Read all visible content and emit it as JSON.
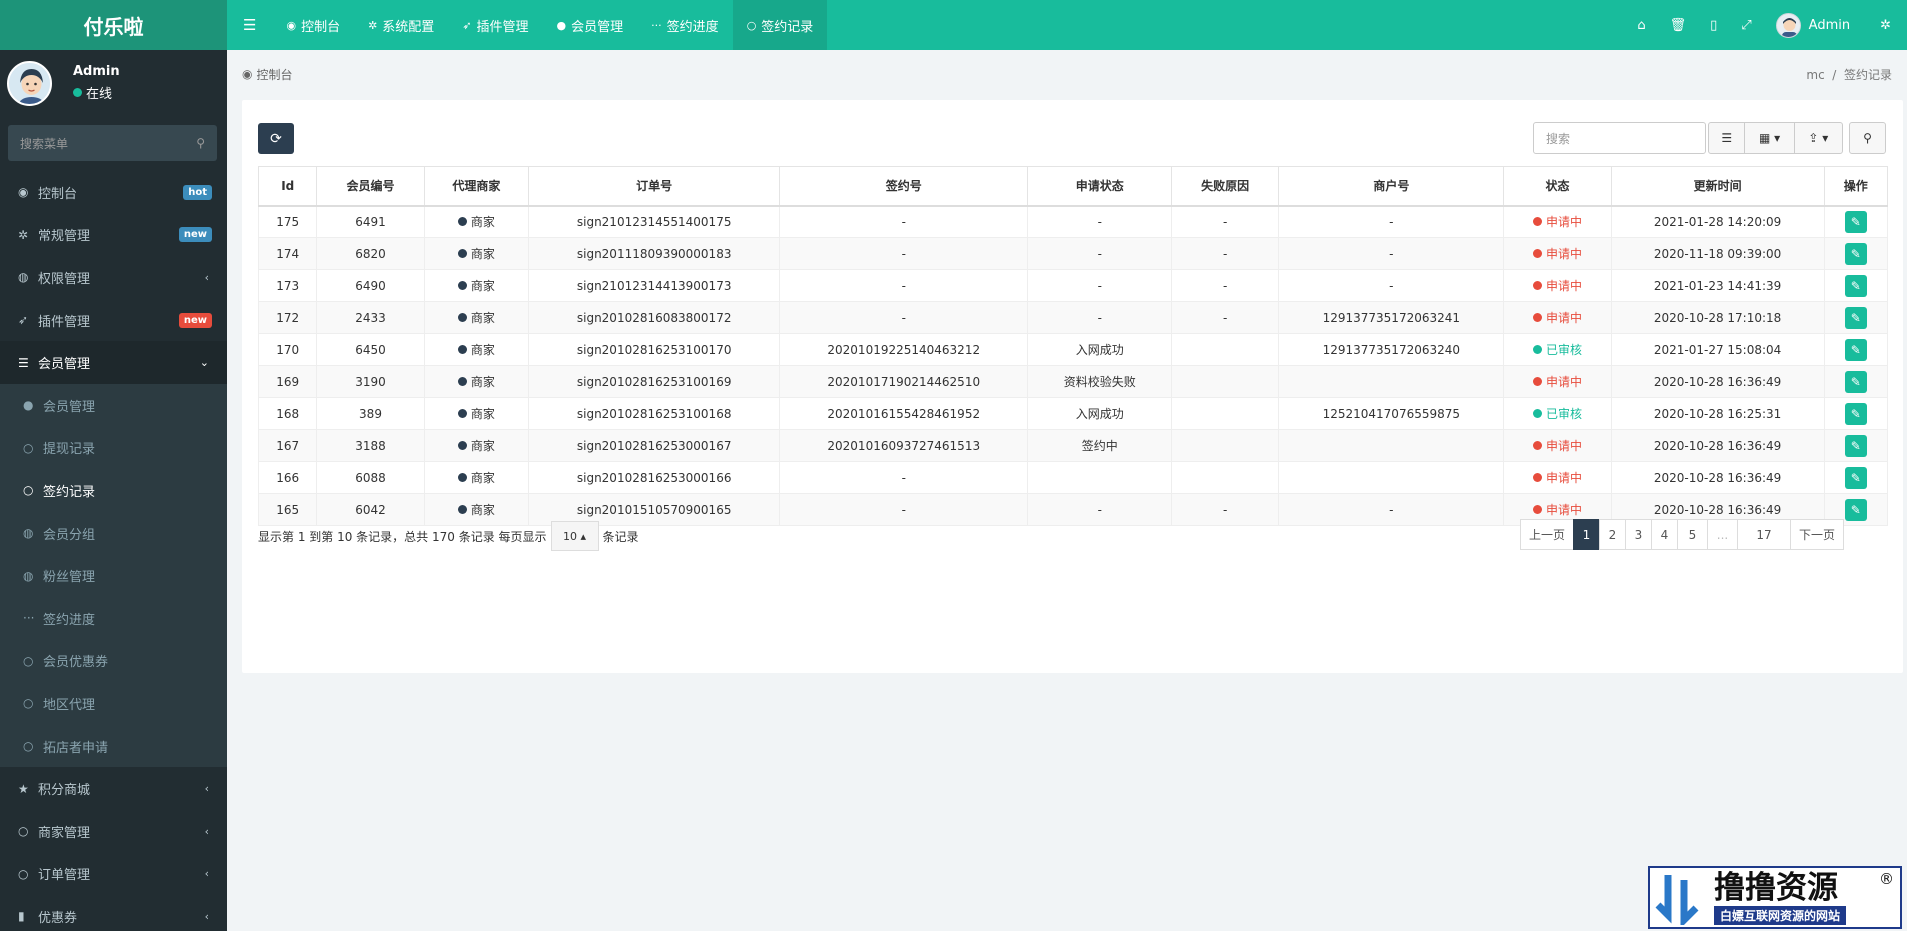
{
  "brand": "付乐啦",
  "topnav": {
    "items": [
      {
        "label": "控制台",
        "icon": "dashboard-icon"
      },
      {
        "label": "系统配置",
        "icon": "gear-icon"
      },
      {
        "label": "插件管理",
        "icon": "rocket-icon"
      },
      {
        "label": "会员管理",
        "icon": "user-icon"
      },
      {
        "label": "签约进度",
        "icon": "ellipsis-icon"
      },
      {
        "label": "签约记录",
        "icon": "circle-icon",
        "active": true
      }
    ],
    "user_name": "Admin"
  },
  "sidebar": {
    "user": {
      "name": "Admin",
      "status": "在线"
    },
    "search_placeholder": "搜索菜单",
    "menu": [
      {
        "label": "控制台",
        "badge": "hot",
        "badge_color": "#3c8dbc",
        "icon": "dashboard-icon"
      },
      {
        "label": "常规管理",
        "badge": "new",
        "badge_color": "#3c8dbc",
        "icon": "cogs-icon"
      },
      {
        "label": "权限管理",
        "arrow": "‹",
        "icon": "group-icon"
      },
      {
        "label": "插件管理",
        "badge": "new",
        "badge_color": "#e74c3c",
        "icon": "rocket-icon"
      },
      {
        "label": "会员管理",
        "arrow": "⌄",
        "icon": "list-icon",
        "open": true
      }
    ],
    "submenu": [
      {
        "label": "会员管理",
        "icon": "user-icon"
      },
      {
        "label": "提现记录",
        "icon": "circle-icon"
      },
      {
        "label": "签约记录",
        "icon": "circle-icon",
        "active": true
      },
      {
        "label": "会员分组",
        "icon": "group-icon"
      },
      {
        "label": "粉丝管理",
        "icon": "group-icon"
      },
      {
        "label": "签约进度",
        "icon": "ellipsis-icon"
      },
      {
        "label": "会员优惠券",
        "icon": "circle-icon"
      },
      {
        "label": "地区代理",
        "icon": "circle-icon"
      },
      {
        "label": "拓店者申请",
        "icon": "circle-icon"
      }
    ],
    "menu2": [
      {
        "label": "积分商城",
        "icon": "star-icon"
      },
      {
        "label": "商家管理",
        "icon": "circle-icon"
      },
      {
        "label": "订单管理",
        "icon": "circle-icon"
      },
      {
        "label": "优惠券",
        "icon": "bookmark-icon"
      }
    ]
  },
  "breadcrumb": {
    "current": "控制台",
    "path": [
      "mc",
      "签约记录"
    ]
  },
  "toolbar": {
    "search_placeholder": "搜索"
  },
  "table": {
    "headers": [
      "Id",
      "会员编号",
      "代理商家",
      "订单号",
      "签约号",
      "申请状态",
      "失败原因",
      "商户号",
      "状态",
      "更新时间",
      "操作"
    ],
    "rows": [
      [
        "175",
        "6491",
        "商家",
        "sign21012314551400175",
        "-",
        "-",
        "-",
        "-",
        "申请中",
        "2021-01-28 14:20:09"
      ],
      [
        "174",
        "6820",
        "商家",
        "sign20111809390000183",
        "-",
        "-",
        "-",
        "-",
        "申请中",
        "2020-11-18 09:39:00"
      ],
      [
        "173",
        "6490",
        "商家",
        "sign21012314413900173",
        "-",
        "-",
        "-",
        "-",
        "申请中",
        "2021-01-23 14:41:39"
      ],
      [
        "172",
        "2433",
        "商家",
        "sign20102816083800172",
        "-",
        "-",
        "-",
        "129137735172063241",
        "申请中",
        "2020-10-28 17:10:18"
      ],
      [
        "170",
        "6450",
        "商家",
        "sign20102816253100170",
        "20201019225140463212",
        "入网成功",
        "",
        "129137735172063240",
        "已审核",
        "2021-01-27 15:08:04"
      ],
      [
        "169",
        "3190",
        "商家",
        "sign20102816253100169",
        "20201017190214462510",
        "资料校验失败",
        "",
        "",
        "申请中",
        "2020-10-28 16:36:49"
      ],
      [
        "168",
        "389",
        "商家",
        "sign20102816253100168",
        "20201016155428461952",
        "入网成功",
        "",
        "125210417076559875",
        "已审核",
        "2020-10-28 16:25:31"
      ],
      [
        "167",
        "3188",
        "商家",
        "sign20102816253000167",
        "20201016093727461513",
        "签约中",
        "",
        "",
        "申请中",
        "2020-10-28 16:36:49"
      ],
      [
        "166",
        "6088",
        "商家",
        "sign20102816253000166",
        "-",
        "",
        "",
        "",
        "申请中",
        "2020-10-28 16:36:49"
      ],
      [
        "165",
        "6042",
        "商家",
        "sign20101510570900165",
        "-",
        "-",
        "-",
        "-",
        "申请中",
        "2020-10-28 16:36:49"
      ]
    ]
  },
  "status_colors": {
    "申请中": "#e74c3c",
    "已审核": "#18bc9c"
  },
  "pagination": {
    "info_prefix": "显示第 1 到第 10 条记录，总共 170 条记录 每页显示",
    "per_page": "10 ▴",
    "info_suffix": "条记录",
    "prev": "上一页",
    "pages": [
      "1",
      "2",
      "3",
      "4",
      "5",
      "...",
      "17"
    ],
    "next": "下一页",
    "current": "1"
  },
  "watermark": {
    "title": "撸撸资源",
    "subtitle": "白嫖互联网资源的网站",
    "mark": "®"
  }
}
